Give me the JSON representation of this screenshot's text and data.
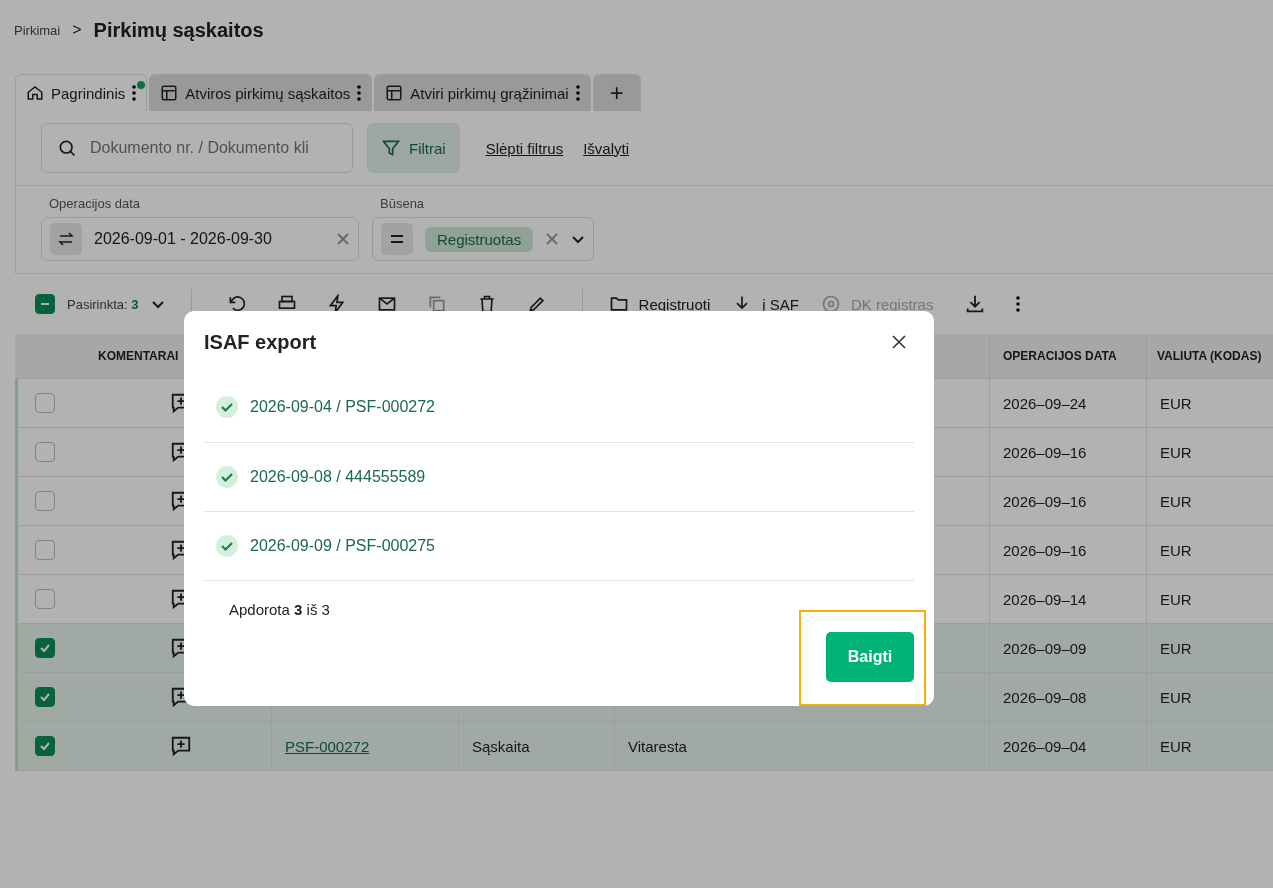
{
  "breadcrumb": {
    "parent": "Pirkimai",
    "separator": ">",
    "title": "Pirkimų sąskaitos"
  },
  "tabs": [
    {
      "label": "Pagrindinis",
      "selected": true,
      "modified": true
    },
    {
      "label": "Atviros pirkimų sąskaitos",
      "selected": false,
      "modified": false
    },
    {
      "label": "Atviri pirkimų grąžinimai",
      "selected": false,
      "modified": false
    }
  ],
  "add_tab": "+",
  "search": {
    "placeholder": "Dokumento nr. / Dokumento kli"
  },
  "filter_button": "Filtrai",
  "links": [
    "Slėpti filtrus",
    "Išvalyti"
  ],
  "filters": [
    {
      "kind": "range",
      "label": "Operacijos data",
      "value": "2026-09-01 - 2026-09-30"
    },
    {
      "kind": "tag",
      "label": "Būsena",
      "value": "Registruotas"
    }
  ],
  "toolbar": {
    "select_all_partial": true,
    "selected_label": "Pasirinkta:",
    "selected_count": "3",
    "actions": [
      {
        "label": "Registruoti",
        "disabled": false
      },
      {
        "label": "į SAF",
        "disabled": false
      },
      {
        "label": "DK registras",
        "disabled": true
      }
    ]
  },
  "table": {
    "columns": [
      "KOMENTARAI",
      "OPERACIJOS DATA",
      "VALIUTA (KODAS)"
    ],
    "rows": [
      {
        "selected": false,
        "date": "2026–09–24",
        "currency": "EUR"
      },
      {
        "selected": false,
        "date": "2026–09–16",
        "currency": "EUR"
      },
      {
        "selected": false,
        "date": "2026–09–16",
        "currency": "EUR"
      },
      {
        "selected": false,
        "date": "2026–09–16",
        "currency": "EUR"
      },
      {
        "selected": false,
        "date": "2026–09–14",
        "currency": "EUR"
      },
      {
        "selected": true,
        "date": "2026–09–09",
        "currency": "EUR"
      },
      {
        "selected": true,
        "date": "2026–09–08",
        "currency": "EUR"
      },
      {
        "selected": true,
        "document": "PSF-000272",
        "type": "Sąskaita",
        "supplier": "Vitaresta",
        "date": "2026–09–04",
        "currency": "EUR"
      }
    ]
  },
  "dialog": {
    "title": "ISAF export",
    "items": [
      {
        "text": "2026-09-04 / PSF-000272",
        "done": true
      },
      {
        "text": "2026-09-08 / 444555589",
        "done": true
      },
      {
        "text": "2026-09-09 / PSF-000275",
        "done": true
      }
    ],
    "progress": "Apdorota **3** iš 3",
    "button": "Baigti",
    "button_highlighted": true
  }
}
